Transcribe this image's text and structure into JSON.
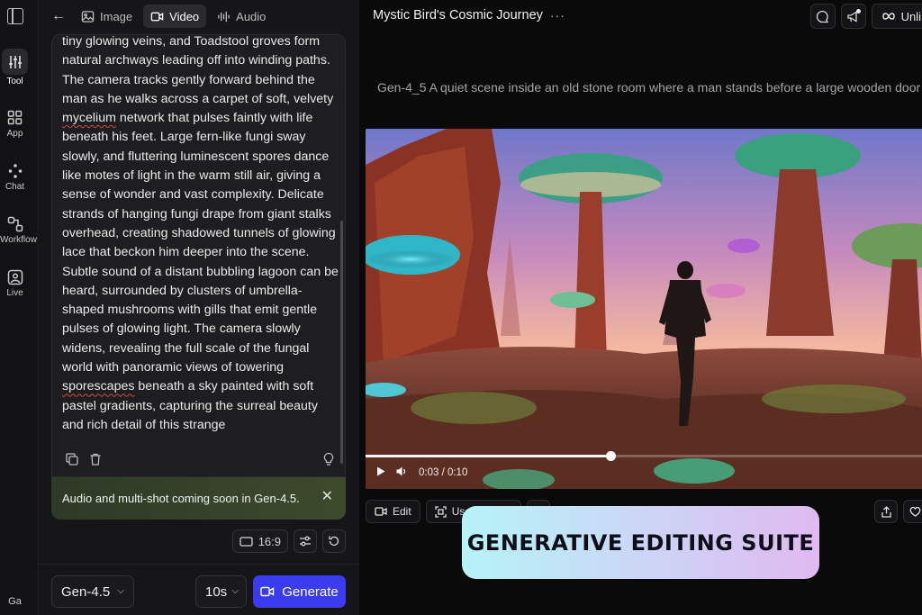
{
  "rail": {
    "items": [
      {
        "label": "Tool",
        "icon": "sliders-icon"
      },
      {
        "label": "App",
        "icon": "grid-icon"
      },
      {
        "label": "Chat",
        "icon": "sparkle-nodes-icon"
      },
      {
        "label": "Workflow",
        "icon": "workflow-icon"
      },
      {
        "label": "Live",
        "icon": "live-icon"
      }
    ],
    "footer": "Ga"
  },
  "modes": {
    "image": "Image",
    "video": "Video",
    "audio": "Audio"
  },
  "prompt": {
    "p1": "tiny glowing veins, and Toadstool groves form natural archways leading off into winding paths. The camera tracks gently forward behind the man as he walks across a carpet of soft, velvety ",
    "w1": "mycelium",
    "p2": " network that pulses faintly with life beneath his feet. Large fern-like fungi sway slowly, and fluttering luminescent spores dance like motes of light in the warm still air, giving a sense of wonder and vast complexity. Delicate strands of hanging fungi drape from giant stalks overhead, creating shadowed tunnels of glowing lace that beckon him deeper into the scene. Subtle sound of a distant bubbling lagoon can be heard, surrounded by clusters of umbrella-shaped mushrooms with gills that emit gentle pulses of glowing light. The camera slowly widens, revealing the full scale of the fungal world with panoramic views of towering ",
    "w2": "sporescapes",
    "p3": " beneath a sky painted with soft pastel gradients, capturing the surreal beauty and rich detail of this strange"
  },
  "notice": {
    "text": "Audio and multi-shot coming soon in Gen-4.5."
  },
  "settings": {
    "aspect": "16:9",
    "model": "Gen-4.5",
    "duration": "10s",
    "generate": "Generate"
  },
  "main": {
    "title": "Mystic Bird's Cosmic Journey",
    "unlimited_partial": "Unli",
    "caption": "Gen-4_5 A quiet scene inside an old stone room where a man stands before a large wooden door",
    "time": "0:03 / 0:10",
    "progress": 0.44,
    "edit": "Edit",
    "use_partial": "Use"
  },
  "overlay": {
    "text": "GENERATIVE EDITING SUITE"
  },
  "colors": {
    "accent": "#3b3cf0",
    "notice_bg": "#34422a"
  }
}
